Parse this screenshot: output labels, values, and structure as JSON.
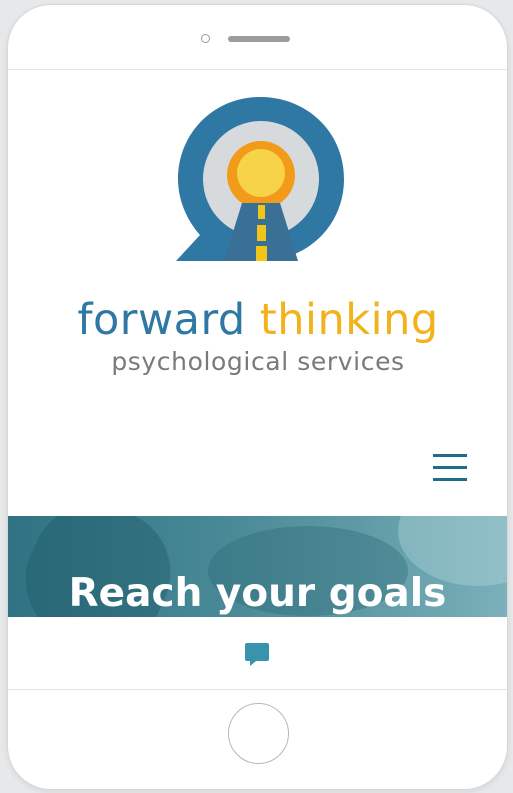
{
  "device": {
    "frame": "phone-mockup"
  },
  "logo": {
    "mark_icon": "road-to-sun-speech-bubble-icon",
    "colors": {
      "bubble": "#2f78a3",
      "ring": "#d7dadd",
      "sun_outer": "#f29b1a",
      "sun_inner": "#f7d34a",
      "road": "#3a6f96",
      "road_line": "#f2c51b"
    },
    "word1": "forward",
    "word2": "thinking",
    "tagline": "psychological services"
  },
  "nav": {
    "menu_icon": "hamburger-menu-icon",
    "color": "#1f6d86"
  },
  "hero": {
    "title": "Reach your goals"
  },
  "chat": {
    "icon": "chat-bubble-icon",
    "color": "#3a93ad"
  }
}
